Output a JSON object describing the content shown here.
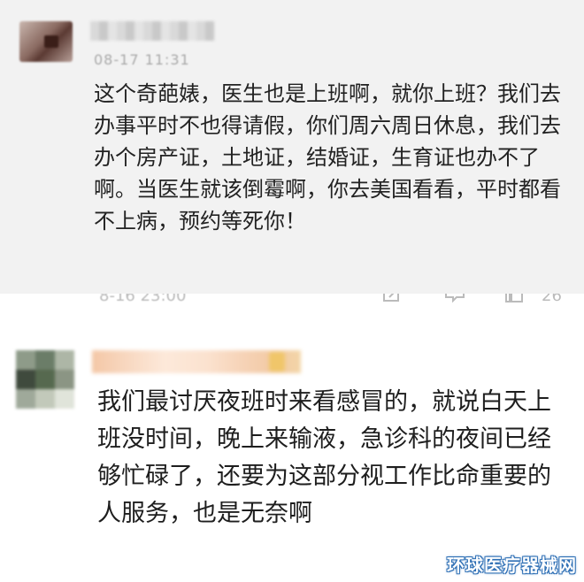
{
  "comments": [
    {
      "time": "08-17 11:31",
      "text": "这个奇葩婊，医生也是上班啊，就你上班？我们去办事平时不也得请假，你们周六周日休息，我们去办个房产证，土地证，结婚证，生育证也办不了啊。当医生就该倒霉啊，你去美国看看，平时都看不上病，预约等死你！",
      "meta_time": "8-16 23:00",
      "like_count": "26",
      "icons": [
        "edit-icon",
        "comment-icon",
        "like-icon"
      ]
    },
    {
      "text": "我们最讨厌夜班时来看感冒的，就说白天上班没时间，晚上来输液，急诊科的夜间已经够忙碌了，还要为这部分视工作比命重要的人服务，也是无奈啊"
    }
  ],
  "watermark": "环球医疗器械网"
}
